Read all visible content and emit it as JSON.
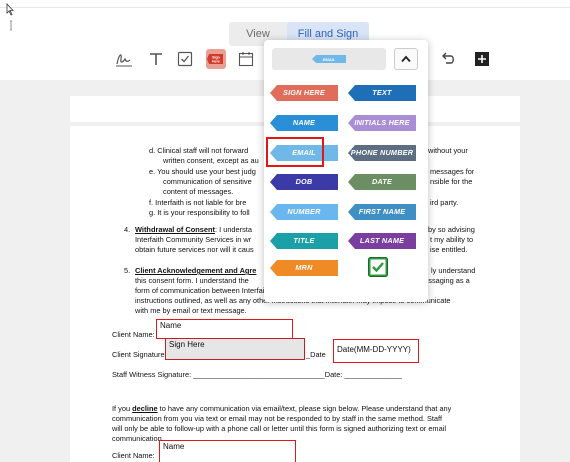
{
  "view_toggle": {
    "view_label": "View",
    "fill_sign_label": "Fill and Sign"
  },
  "toolbar": {
    "icons": [
      "signature-icon",
      "text-icon",
      "checkbox-icon",
      "sign-here-icon",
      "calendar-icon",
      "undo-icon",
      "add-field-icon"
    ],
    "sign_icon_text": "Sign Here"
  },
  "palette": {
    "header_tag": "EMAIL",
    "tags": [
      {
        "label": "SIGN HERE",
        "color": "#e06c5a"
      },
      {
        "label": "TEXT",
        "color": "#1f6fb8"
      },
      {
        "label": "NAME",
        "color": "#2a8fd6"
      },
      {
        "label": "INITIALS HERE",
        "color": "#a98ed6"
      },
      {
        "label": "EMAIL",
        "color": "#6fb8e8"
      },
      {
        "label": "PHONE NUMBER",
        "color": "#5e6e82"
      },
      {
        "label": "DOB",
        "color": "#3b3aa6"
      },
      {
        "label": "DATE",
        "color": "#6b8f62"
      },
      {
        "label": "NUMBER",
        "color": "#6ab6ee"
      },
      {
        "label": "FIRST NAME",
        "color": "#3e8fc4"
      },
      {
        "label": "TITLE",
        "color": "#1aa0a6"
      },
      {
        "label": "LAST NAME",
        "color": "#7a3f9e"
      },
      {
        "label": "MRN",
        "color": "#f08a24"
      }
    ]
  },
  "document": {
    "d1": "d.   Clinical staff will not forward",
    "d1r": "without your",
    "d2": "written consent, except as au",
    "e1": "e.   You should use your best judg",
    "e1r": "messages for",
    "e2": "communication of sensitive",
    "e2r": "nsible for the",
    "e3": "content of messages.",
    "f1": "f.    Interfaith is not liable for bre",
    "f1r": "ird party.",
    "g1": "g.   It is your responsibility to foll",
    "s4_num": "4.",
    "s4_title": "Withdrawal of Consent",
    "s4a": ": I understa",
    "s4ar": "by so advising",
    "s4b": "Interfaith Community Services in wr",
    "s4br": "t my ability to",
    "s4c": "obtain future services nor will it caus",
    "s4cr": "ise entitled.",
    "s5_num": "5.",
    "s5_title": "Client Acknowledgement and Agre",
    "s5ar": "ly understand",
    "s5b": "this consent form.  I understand the",
    "s5br": "messaging as a",
    "s5c": "form of communication between Interfaith staff and me, and consent to the conditions and",
    "s5d": "instructions outlined, as well as any other instructions that Interfaith may impose to communicate",
    "s5e": "with me by email or text message.",
    "client_name_label": "Client Name:",
    "client_sig_label": "Client Signature",
    "date_label": "_Date",
    "witness": "Staff Witness Signature: ________________________________Date: ______________",
    "decline_pre": "If you ",
    "decline_word": "decline",
    "decline_post": " to have any communication via email/text, please sign below. Please understand that any",
    "decline2": "communication from you via text or email may not be responded to by staff in the same method. Staff",
    "decline3": "will only be able to follow-up with a phone call or letter until this form is signed authorizing text or email",
    "decline4": "communication.",
    "client_name_label2": "Client Name:"
  },
  "fields": {
    "name1": "Name",
    "sign_here": "Sign Here",
    "date": "Date(MM-DD-YYYY)",
    "name2": "Name"
  }
}
